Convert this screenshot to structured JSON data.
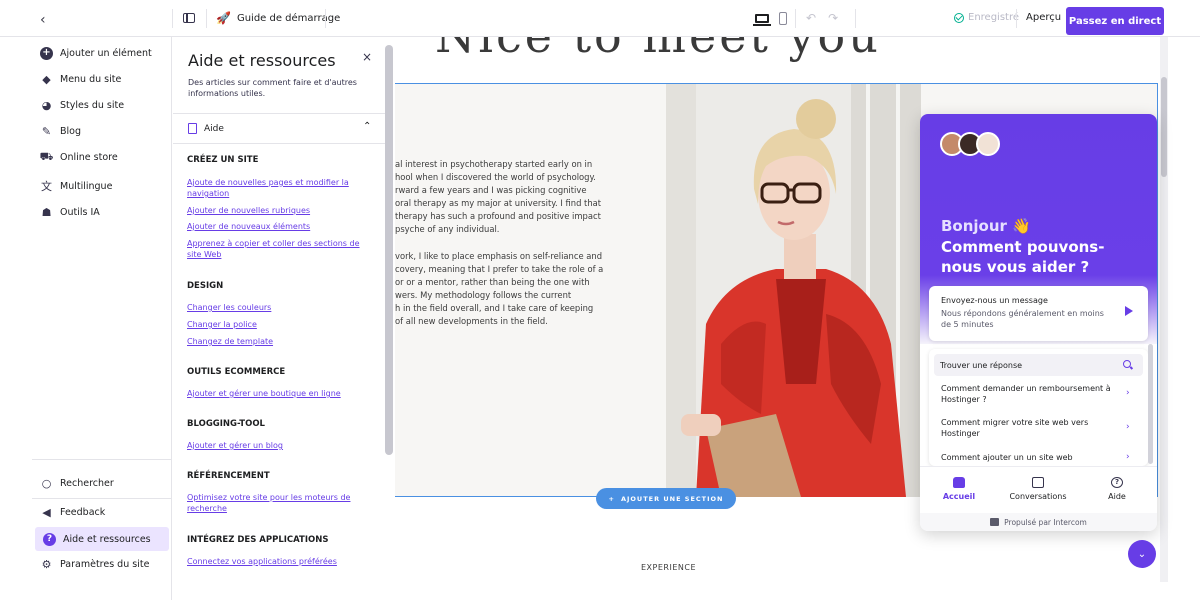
{
  "topbar": {
    "back": "‹",
    "guide_label": "Guide de démarrage",
    "saved_label": "Enregistré",
    "preview_label": "Aperçu",
    "publish_label": "Passez en direct"
  },
  "leftnav": {
    "items": [
      {
        "label": "Ajouter un élément",
        "icon": "plus-circle-icon"
      },
      {
        "label": "Menu du site",
        "icon": "layers-icon"
      },
      {
        "label": "Styles du site",
        "icon": "palette-icon"
      },
      {
        "label": "Blog",
        "icon": "edit-icon"
      },
      {
        "label": "Online store",
        "icon": "cart-icon"
      },
      {
        "label": "Multilingue",
        "icon": "translate-icon"
      },
      {
        "label": "Outils IA",
        "icon": "robot-icon"
      }
    ],
    "bottom_items": [
      {
        "label": "Rechercher",
        "icon": "search-icon"
      },
      {
        "label": "Feedback",
        "icon": "megaphone-icon"
      },
      {
        "label": "Aide et ressources",
        "icon": "help-icon"
      },
      {
        "label": "Paramètres du site",
        "icon": "gear-icon"
      }
    ]
  },
  "help": {
    "title": "Aide et ressources",
    "close": "×",
    "description": "Des articles sur comment faire et d'autres informations utiles.",
    "aide_label": "Aide",
    "sections": [
      {
        "title": "CRÉEZ UN SITE",
        "links": [
          "Ajoute de nouvelles pages et modifier la navigation",
          "Ajouter de nouvelles rubriques",
          "Ajouter de nouveaux éléments",
          "Apprenez à copier et coller des sections de site Web"
        ]
      },
      {
        "title": "DESIGN",
        "links": [
          "Changer les couleurs",
          "Changer la police",
          "Changez de template"
        ]
      },
      {
        "title": "OUTILS ECOMMERCE",
        "links": [
          "Ajouter et gérer une boutique en ligne"
        ]
      },
      {
        "title": "BLOGGING-TOOL",
        "links": [
          "Ajouter et gérer un blog"
        ]
      },
      {
        "title": "RÉFÉRENCEMENT",
        "links": [
          "Optimisez votre site pour les moteurs de recherche"
        ]
      },
      {
        "title": "INTÉGREZ DES APPLICATIONS",
        "links": [
          "Connectez vos applications préférées"
        ]
      }
    ]
  },
  "canvas": {
    "headline": "Nice to meet you",
    "bio_p1": "al interest in psychotherapy started early on in\nhool when I discovered the world of psychology.\nrward a few years and I was picking cognitive\noral therapy as my major at university. I find that\ntherapy has such a profound and positive impact\npsyche of any individual.",
    "bio_p2": "vork, I like to place emphasis on self-reliance and\ncovery, meaning that I prefer to take the role of a\nor or a mentor, rather than being the one with\nwers. My methodology follows the current\nh in the field overall, and I take care of keeping\nof all new developments in the field.",
    "add_section_label": "AJOUTER UNE SECTION",
    "experience_label": "EXPERIENCE"
  },
  "intercom": {
    "greeting": "Bonjour 👋",
    "headline": "Comment pouvons-nous vous aider ?",
    "message_title": "Envoyez-nous un message",
    "message_sub": "Nous répondons généralement en moins de 5 minutes",
    "find_title": "Trouver une réponse",
    "questions": [
      "Comment demander un remboursement à Hostinger ?",
      "Comment migrer votre site web vers Hostinger",
      "Comment ajouter un un site web"
    ],
    "tabs": [
      "Accueil",
      "Conversations",
      "Aide"
    ],
    "powered": "Propulsé par Intercom"
  },
  "colors": {
    "accent": "#673de6",
    "section_border": "#4a90e2"
  }
}
